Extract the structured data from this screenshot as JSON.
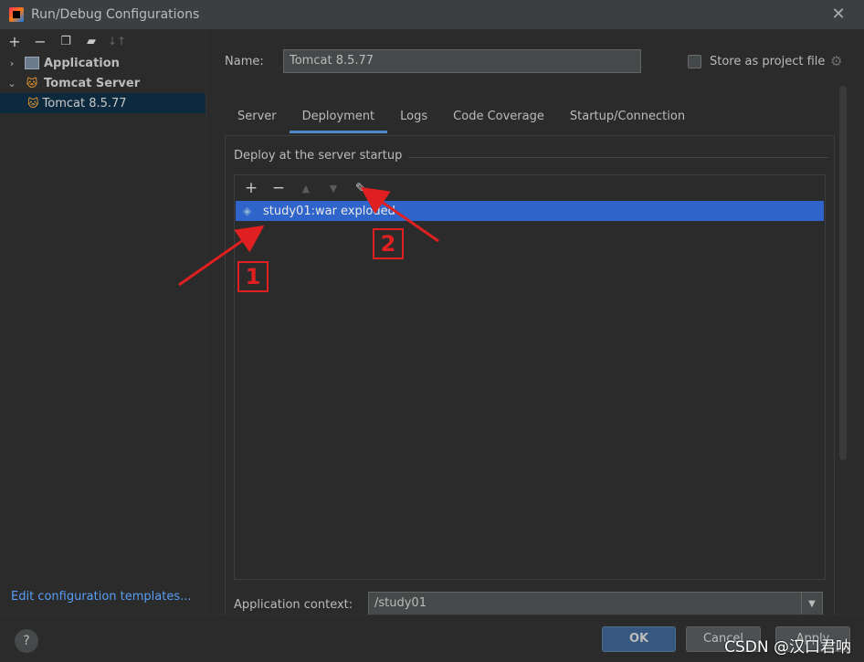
{
  "window": {
    "title": "Run/Debug Configurations",
    "close_icon": "close-icon"
  },
  "sidebar": {
    "toolbar": [
      "add-icon",
      "remove-icon",
      "copy-icon",
      "folder-icon",
      "sort-icon"
    ],
    "items": [
      {
        "label": "Application",
        "expanded": false
      },
      {
        "label": "Tomcat Server",
        "expanded": true
      },
      {
        "label": "Tomcat 8.5.77",
        "selected": true
      }
    ],
    "edit_templates": "Edit configuration templates..."
  },
  "config": {
    "name_label": "Name:",
    "name_value": "Tomcat 8.5.77",
    "store_label": "Store as project file",
    "store_checked": false
  },
  "tabs": [
    {
      "label": "Server",
      "active": false
    },
    {
      "label": "Deployment",
      "active": true
    },
    {
      "label": "Logs",
      "active": false
    },
    {
      "label": "Code Coverage",
      "active": false
    },
    {
      "label": "Startup/Connection",
      "active": false
    }
  ],
  "deployment": {
    "section_title": "Deploy at the server startup",
    "toolbar": [
      "add-icon",
      "remove-icon",
      "move-up-icon",
      "move-down-icon",
      "edit-icon"
    ],
    "items": [
      {
        "label": "study01:war exploded",
        "selected": true
      }
    ],
    "context_label": "Application context:",
    "context_value": "/study01"
  },
  "buttons": {
    "ok": "OK",
    "cancel": "Cancel",
    "apply": "Apply",
    "help": "?"
  },
  "annotations": {
    "one": "1",
    "two": "2",
    "color": "#e02020"
  },
  "watermark": "CSDN @汉口君呐",
  "colors": {
    "accent": "#4a88c7",
    "selection": "#2f65ca",
    "background": "#2b2b2b"
  }
}
